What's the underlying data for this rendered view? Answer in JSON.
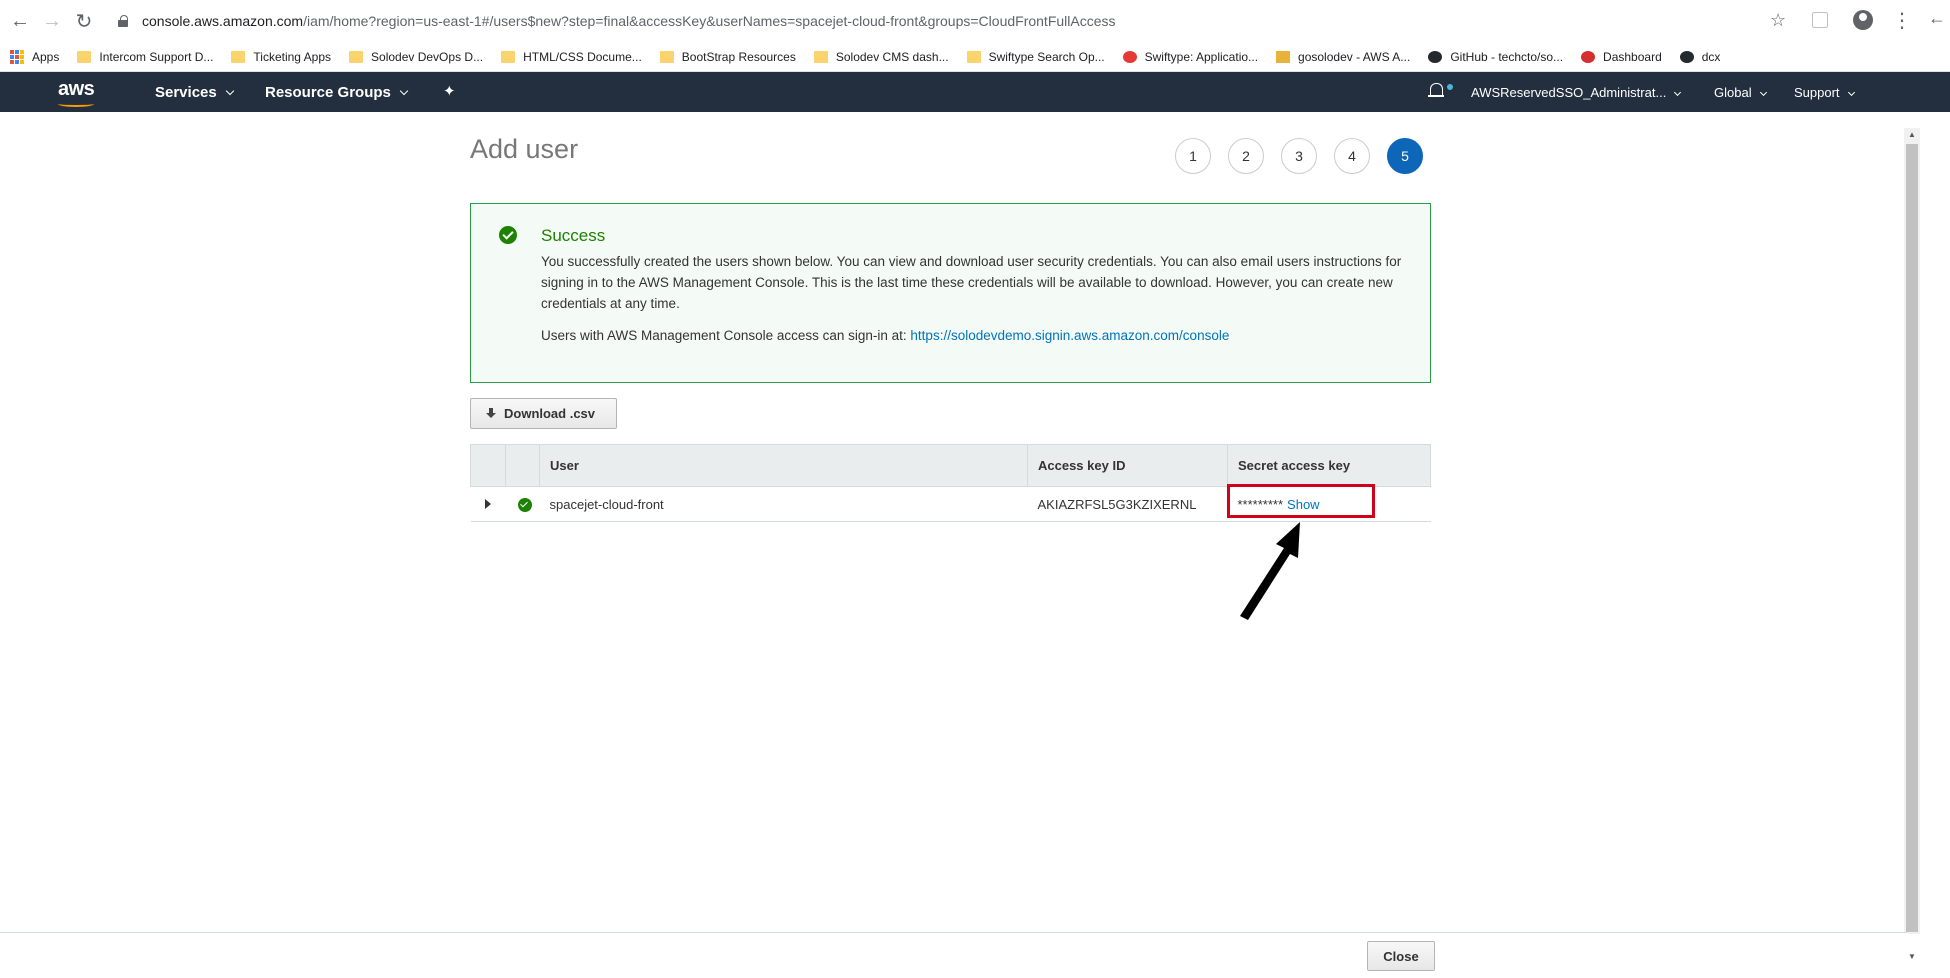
{
  "browser": {
    "url_host": "console.aws.amazon.com",
    "url_rest": "/iam/home?region=us-east-1#/users$new?step=final&accessKey&userNames=spacejet-cloud-front&groups=CloudFrontFullAccess",
    "bookmarks": [
      {
        "label": "Apps",
        "icon": "apps-grid-icon"
      },
      {
        "label": "Intercom Support D...",
        "icon": "folder-icon"
      },
      {
        "label": "Ticketing Apps",
        "icon": "folder-icon"
      },
      {
        "label": "Solodev DevOps D...",
        "icon": "folder-icon"
      },
      {
        "label": "HTML/CSS Docume...",
        "icon": "folder-icon"
      },
      {
        "label": "BootStrap Resources",
        "icon": "folder-icon"
      },
      {
        "label": "Solodev CMS dash...",
        "icon": "folder-icon"
      },
      {
        "label": "Swiftype Search Op...",
        "icon": "folder-icon"
      },
      {
        "label": "Swiftype: Applicatio...",
        "icon": "swiftype-icon"
      },
      {
        "label": "gosolodev - AWS A...",
        "icon": "cube-icon"
      },
      {
        "label": "GitHub - techcto/so...",
        "icon": "github-icon"
      },
      {
        "label": "Dashboard",
        "icon": "gear-red-icon"
      },
      {
        "label": "dcx",
        "icon": "github-icon"
      }
    ]
  },
  "aws_nav": {
    "logo": "aws",
    "services": "Services",
    "resource_groups": "Resource Groups",
    "account": "AWSReservedSSO_Administrat...",
    "region": "Global",
    "support": "Support"
  },
  "page": {
    "title": "Add user",
    "steps": [
      "1",
      "2",
      "3",
      "4",
      "5"
    ],
    "active_step": "5"
  },
  "success": {
    "title": "Success",
    "message": "You successfully created the users shown below. You can view and download user security credentials. You can also email users instructions for signing in to the AWS Management Console. This is the last time these credentials will be available to download. However, you can create new credentials at any time.",
    "signin_prefix": "Users with AWS Management Console access can sign-in at: ",
    "signin_url": "https://solodevdemo.signin.aws.amazon.com/console"
  },
  "download_label": "Download .csv",
  "table": {
    "headers": {
      "user": "User",
      "access_key_id": "Access key ID",
      "secret_access_key": "Secret access key"
    },
    "rows": [
      {
        "user": "spacejet-cloud-front",
        "access_key_id": "AKIAZRFSL5G3KZIXERNL",
        "secret_masked": "*********",
        "show_label": "Show"
      }
    ]
  },
  "footer": {
    "close_label": "Close"
  },
  "colors": {
    "aws_nav_bg": "#232f3e",
    "active_step": "#0e66b9",
    "success_green": "#1d8102",
    "link_blue": "#0073bb",
    "annotation_red": "#d0021b"
  }
}
